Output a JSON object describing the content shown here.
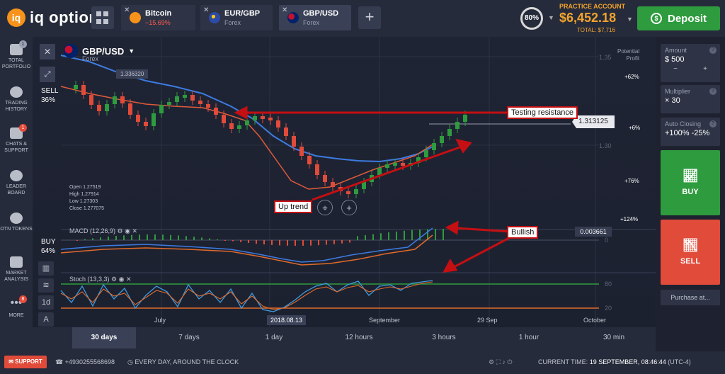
{
  "app": {
    "logo_text": "iq option"
  },
  "tabs": [
    {
      "name": "Bitcoin",
      "sub": "−15.69%",
      "color": "#f7931a"
    },
    {
      "name": "EUR/GBP",
      "sub": "Forex",
      "color": "#2d4aa8"
    },
    {
      "name": "GBP/USD",
      "sub": "Forex",
      "color": "#c8102e"
    }
  ],
  "header": {
    "ring": "80%",
    "account_label": "PRACTICE ACCOUNT",
    "balance": "$6,452.18",
    "total": "TOTAL: $7,716",
    "deposit": "Deposit"
  },
  "sidebar": [
    {
      "label": "TOTAL PORTFOLIO",
      "badge": "1",
      "icon": "briefcase-icon"
    },
    {
      "label": "TRADING HISTORY",
      "badge": "",
      "icon": "history-icon"
    },
    {
      "label": "CHATS & SUPPORT",
      "badge": "1",
      "icon": "chat-icon"
    },
    {
      "label": "LEADER BOARD",
      "badge": "",
      "icon": "leaderboard-icon"
    },
    {
      "label": "OTN TOKENS",
      "badge": "",
      "icon": "token-icon"
    },
    {
      "label": "MARKET ANALYSIS",
      "badge": "",
      "icon": "analysis-icon"
    },
    {
      "label": "MORE",
      "badge": "8",
      "icon": "more-icon"
    }
  ],
  "chart": {
    "pair": "GBP/USD",
    "market": "Forex",
    "sell_label": "SELL",
    "sell_pct": "36%",
    "buy_label": "BUY",
    "buy_pct": "64%",
    "price_tag": "1.336320",
    "current_price": "1.313125",
    "macd_value": "0.003661",
    "ohlc": [
      "Open   1.27519",
      "High   1.27914",
      "Low    1.27303",
      "Close  1.277075"
    ],
    "macd_label": "MACD (12,26,9)",
    "stoch_label": "Stoch (13,3,3)",
    "potential": "Potential",
    "profit": "Profit",
    "pct_labels": [
      "+62%",
      "+6%",
      "+76%",
      "+124%"
    ],
    "y_labels": [
      "1.35",
      "1.30",
      "0",
      "80",
      "20"
    ],
    "time_labels": [
      "July",
      "August",
      "September",
      "29 Sep",
      "October"
    ],
    "date_box": "2018.08.13",
    "annotations": {
      "resistance": "Testing resistance",
      "uptrend": "Up trend",
      "bullish": "Bullish"
    },
    "tools": [
      "1d"
    ]
  },
  "periods": [
    "30 days",
    "7 days",
    "1 day",
    "12 hours",
    "3 hours",
    "1 hour",
    "30 min"
  ],
  "right": {
    "amount_label": "Amount",
    "amount": "$  500",
    "multiplier_label": "Multiplier",
    "multiplier": "× 30",
    "autoclose_label": "Auto Closing",
    "autoclose": "+100%  -25%",
    "buy": "BUY",
    "sell": "SELL",
    "purchase": "Purchase at..."
  },
  "bottom": {
    "support": "SUPPORT",
    "phone": "+4930255568698",
    "tagline": "EVERY DAY, AROUND THE CLOCK",
    "time_label": "CURRENT TIME:",
    "time_value": "19 SEPTEMBER, 08:46:44",
    "tz": "(UTC-4)"
  },
  "colors": {
    "green": "#2e9b3e",
    "red": "#e04b3a",
    "orange": "#f2a32c",
    "annotation": "#c40f13"
  }
}
